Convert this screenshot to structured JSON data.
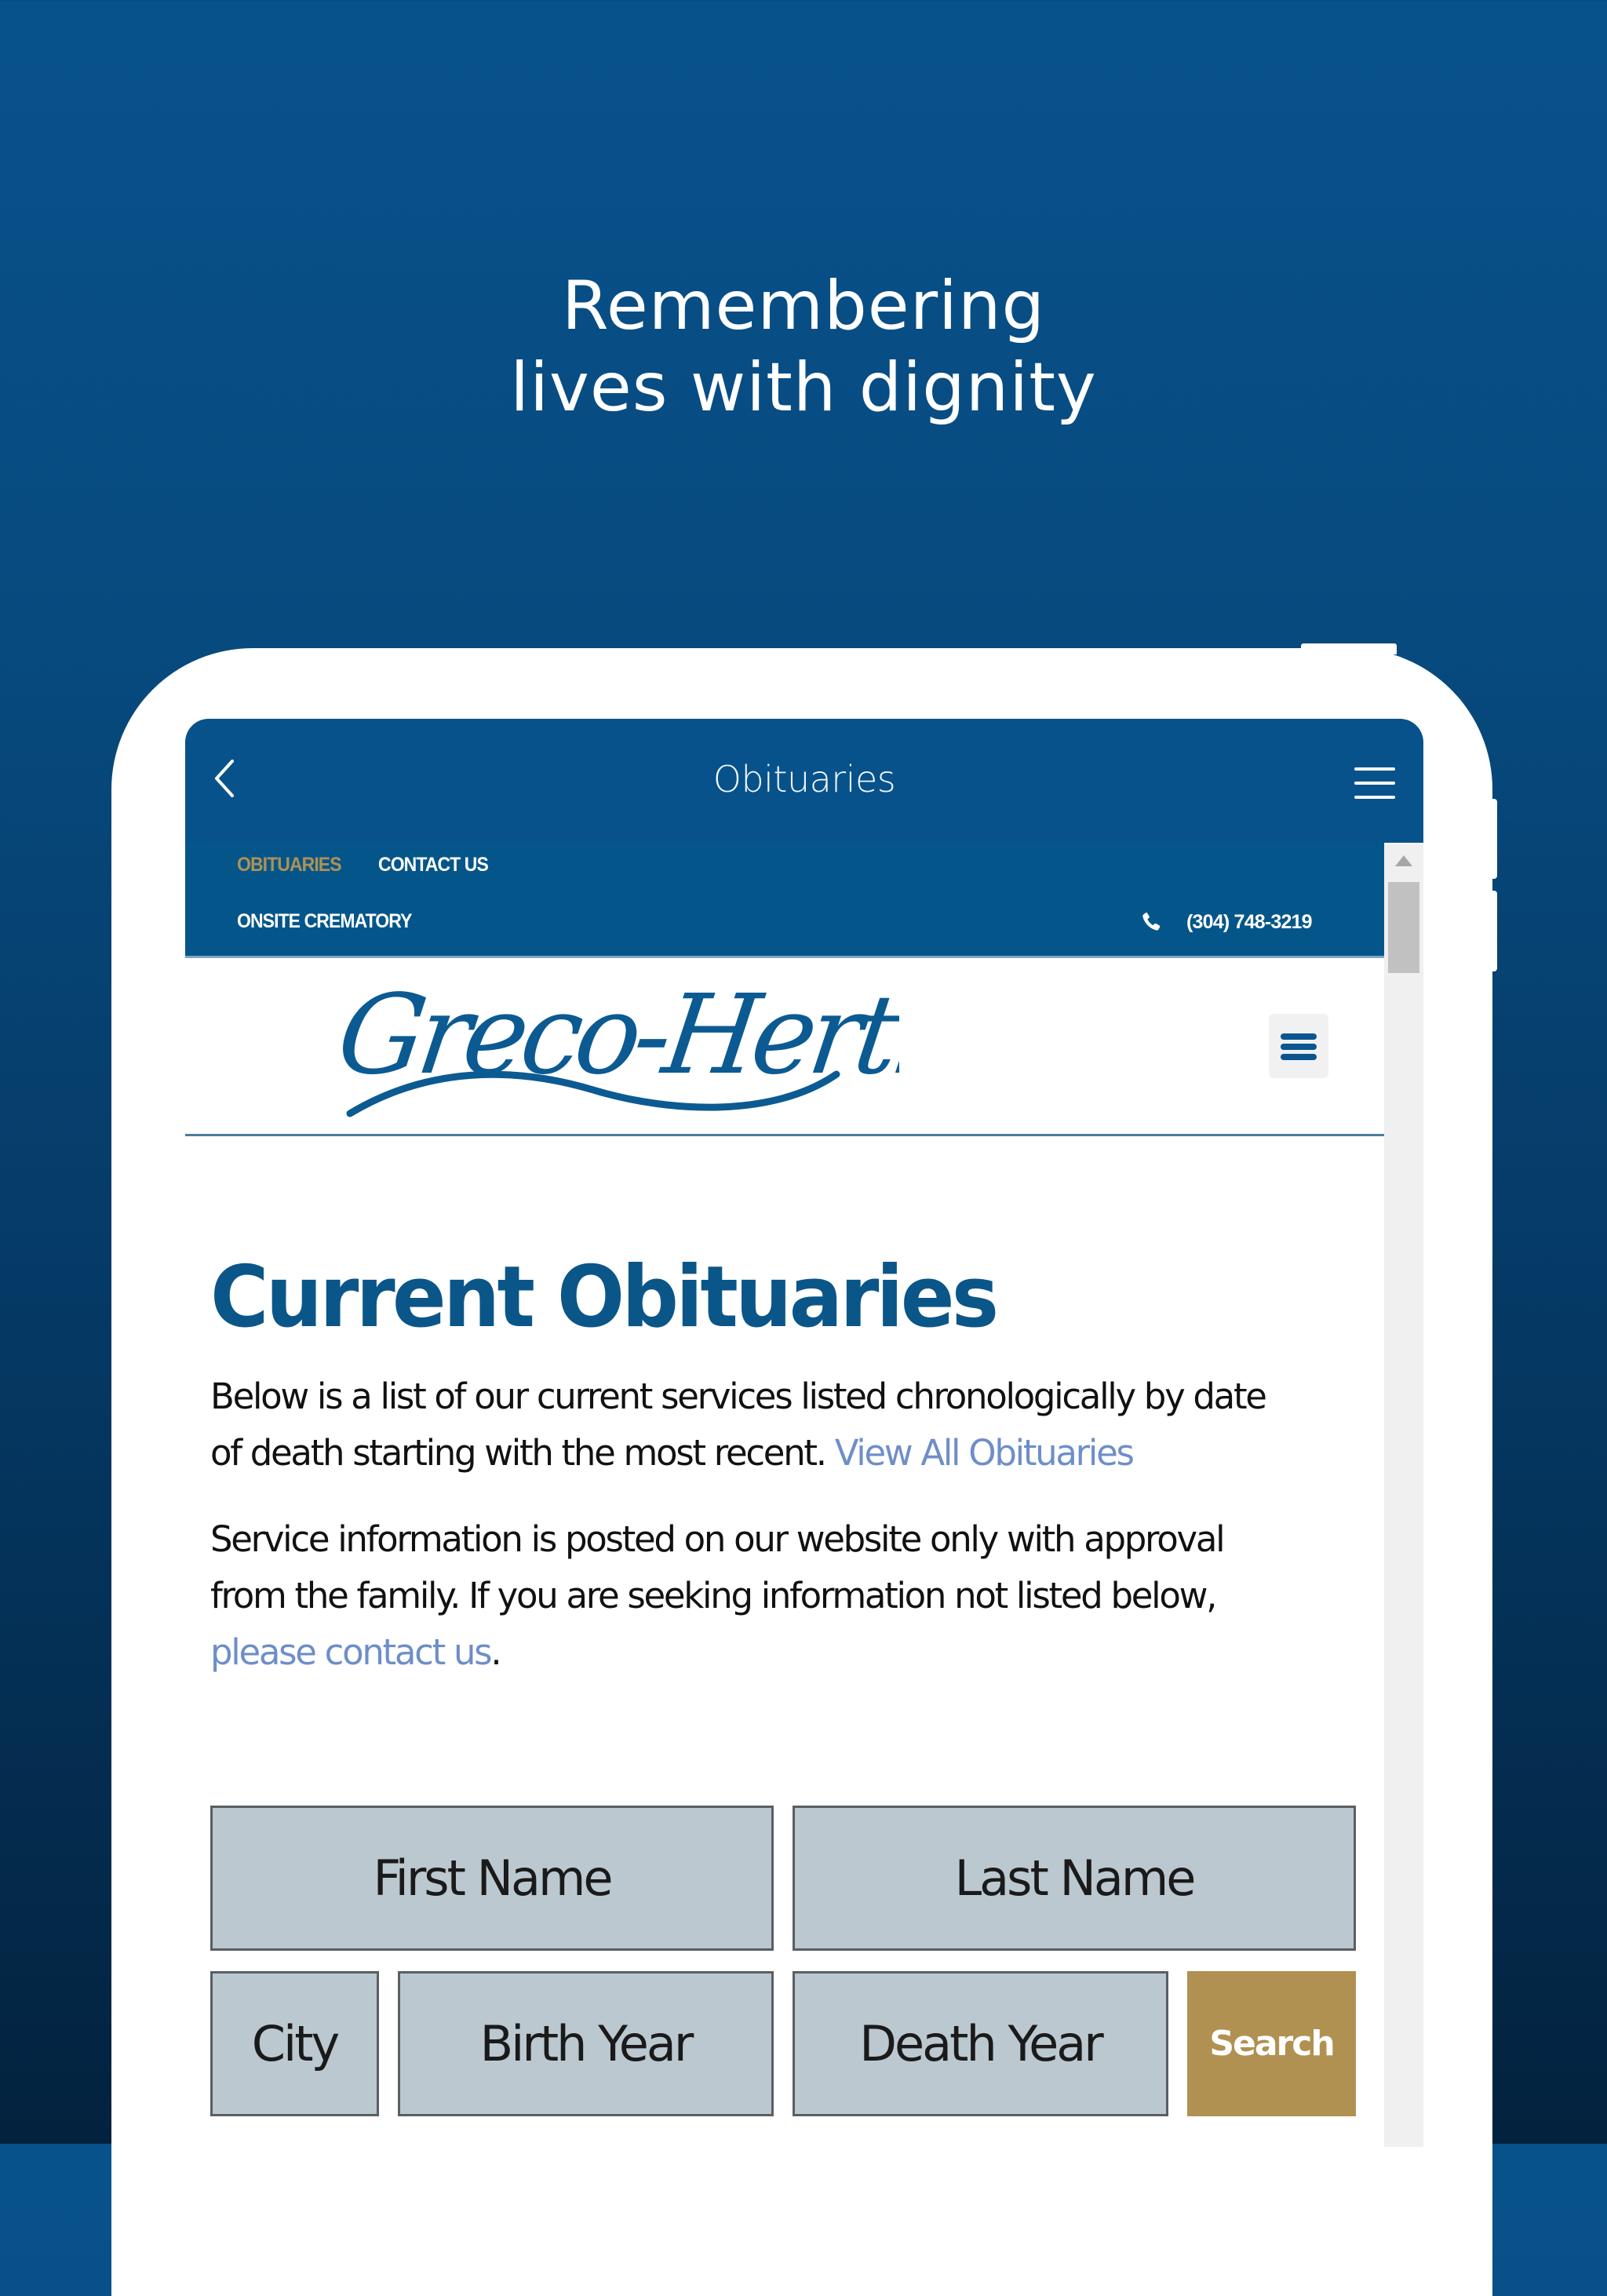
{
  "promo": {
    "tagline_line1": "Remembering",
    "tagline_line2": "lives with dignity"
  },
  "app_header": {
    "title": "Obituaries",
    "back_icon": "chevron-left-icon",
    "menu_icon": "hamburger-menu-icon"
  },
  "site_nav": {
    "items": [
      {
        "label": "OBITUARIES",
        "active": true
      },
      {
        "label": "CONTACT US",
        "active": false
      },
      {
        "label": "ONSITE CREMATORY",
        "active": false
      }
    ],
    "phone_icon": "phone-icon",
    "phone": "(304) 748-3219"
  },
  "site_header": {
    "logo_text": "Greco-Hertnick",
    "menu_icon": "hamburger-menu-icon"
  },
  "main": {
    "heading": "Current Obituaries",
    "intro_text": "Below is a list of our current services listed chronologically by date",
    "intro_text_2": "of death starting with the most recent. ",
    "view_all_link": "View All Obituaries",
    "notice_text": "Service information is posted on our website only with approval",
    "notice_text_2": "from the family. If you are seeking information not listed below,",
    "contact_link": "please contact us",
    "notice_end": "."
  },
  "search_form": {
    "first_name_placeholder": "First Name",
    "last_name_placeholder": "Last Name",
    "city_placeholder": "City",
    "birth_year_placeholder": "Birth Year",
    "death_year_placeholder": "Death Year",
    "search_label": "Search"
  },
  "colors": {
    "brand_blue": "#07528b",
    "accent_gold": "#b09152",
    "link_blue": "#6e8ec9",
    "field_bg": "#bcc8d0"
  }
}
